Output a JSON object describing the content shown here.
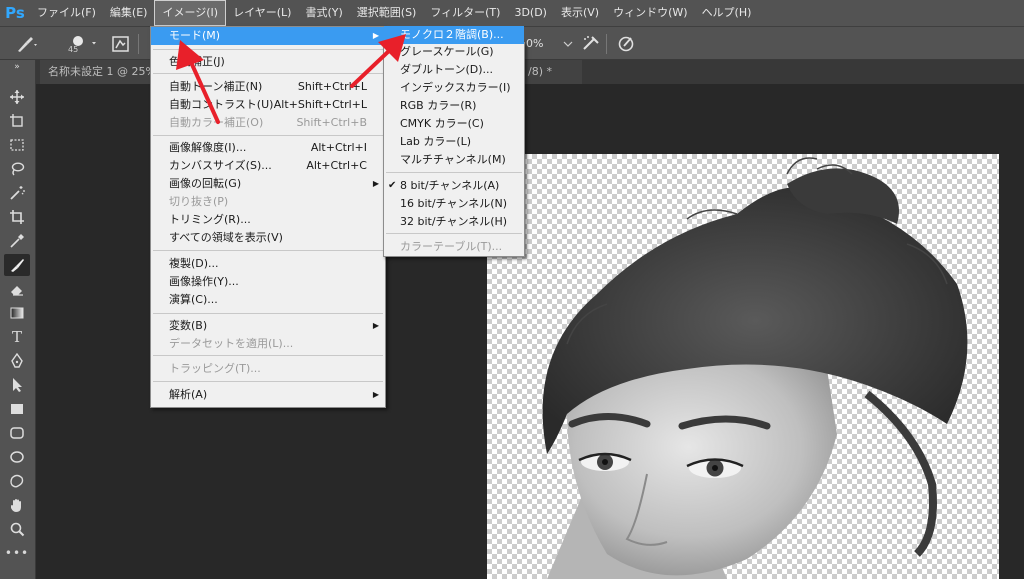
{
  "menubar": {
    "logo": "Ps",
    "items": [
      {
        "label": "ファイル(F)"
      },
      {
        "label": "編集(E)"
      },
      {
        "label": "イメージ(I)"
      },
      {
        "label": "レイヤー(L)"
      },
      {
        "label": "書式(Y)"
      },
      {
        "label": "選択範囲(S)"
      },
      {
        "label": "フィルター(T)"
      },
      {
        "label": "3D(D)"
      },
      {
        "label": "表示(V)"
      },
      {
        "label": "ウィンドウ(W)"
      },
      {
        "label": "ヘルプ(H)"
      }
    ]
  },
  "options": {
    "brush_size": "45",
    "flow_percent": "0%"
  },
  "tabs": {
    "doc1": "名称未設定 1 @ 25%",
    "doc2": "/8) *"
  },
  "image_menu": {
    "mode": "モード(M)",
    "adjust": "色調補正(J)",
    "auto_tone": "自動トーン補正(N)",
    "auto_tone_sc": "Shift+Ctrl+L",
    "auto_contrast": "自動コントラスト(U)",
    "auto_contrast_sc": "Alt+Shift+Ctrl+L",
    "auto_color": "自動カラー補正(O)",
    "auto_color_sc": "Shift+Ctrl+B",
    "image_size": "画像解像度(I)...",
    "image_size_sc": "Alt+Ctrl+I",
    "canvas_size": "カンバスサイズ(S)...",
    "canvas_size_sc": "Alt+Ctrl+C",
    "rotation": "画像の回転(G)",
    "crop": "切り抜き(P)",
    "trim": "トリミング(R)...",
    "reveal_all": "すべての領域を表示(V)",
    "duplicate": "複製(D)...",
    "apply_image": "画像操作(Y)...",
    "calculations": "演算(C)...",
    "variables": "変数(B)",
    "apply_dataset": "データセットを適用(L)...",
    "trap": "トラッピング(T)...",
    "analysis": "解析(A)"
  },
  "mode_submenu": {
    "bitmap": "モノクロ２階調(B)...",
    "grayscale": "グレースケール(G)",
    "duotone": "ダブルトーン(D)...",
    "indexed": "インデックスカラー(I)",
    "rgb": "RGB カラー(R)",
    "cmyk": "CMYK カラー(C)",
    "lab": "Lab カラー(L)",
    "multichannel": "マルチチャンネル(M)",
    "bit8": "8 bit/チャンネル(A)",
    "bit16": "16 bit/チャンネル(N)",
    "bit32": "32 bit/チャンネル(H)",
    "color_table": "カラーテーブル(T)..."
  },
  "colors": {
    "highlight": "#3a9bf1",
    "arrow": "#e8202a",
    "logo": "#31a8ff"
  }
}
